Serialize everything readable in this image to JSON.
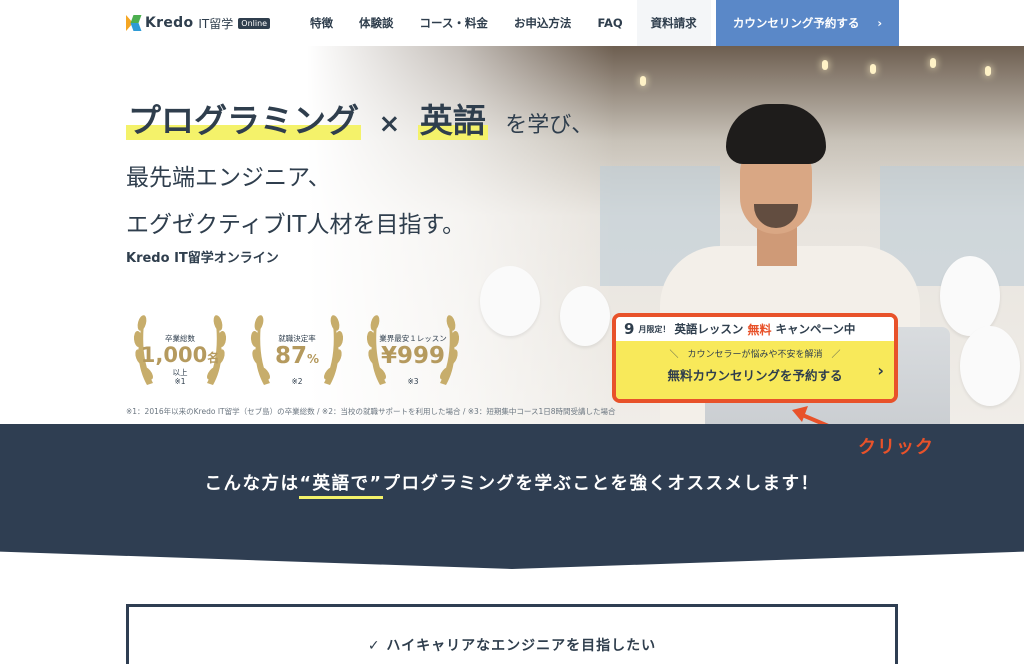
{
  "header": {
    "logo_text": "Kredo",
    "logo_sub": "IT留学",
    "logo_badge": "Online",
    "nav": [
      "特徴",
      "体験談",
      "コース・料金",
      "お申込方法",
      "FAQ",
      "資料請求"
    ],
    "cta_label": "カウンセリング予約する",
    "cta_chevron": "›",
    "cta_color": "#5a88c8"
  },
  "hero": {
    "line1_a": "プログラミング",
    "line1_x": "×",
    "line1_b": "英語",
    "line1_c": "を学び、",
    "line2": "最先端エンジニア、",
    "line3": "エグゼクティブIT人材を目指す。",
    "sub": "Kredo IT留学オンライン",
    "awards": [
      {
        "label": "卒業総数",
        "value": "1,000",
        "unit": "名",
        "extra": "以上",
        "note": "※1"
      },
      {
        "label": "就職決定率",
        "value": "87",
        "unit": "%",
        "extra": "",
        "note": "※2"
      },
      {
        "label": "業界最安１レッスン",
        "value": "¥999",
        "unit": "",
        "extra": "",
        "note": "※3"
      }
    ],
    "footnote": "※1：2016年以来のKredo IT留学（セブ島）の卒業総数 / ※2：当校の就職サポートを利用した場合 / ※3：短期集中コース1日8時間受講した場合",
    "accent_color": "#f4f26a",
    "gold_color": "#b59a5e"
  },
  "campaign": {
    "month": "9",
    "limited": "月限定！",
    "lesson": "英語レッスン",
    "free": "無料",
    "campaign": "キャンペーン中",
    "note": "＼　カウンセラーが悩みや不安を解消　／",
    "button": "無料カウンセリングを予約する",
    "chevron": "›",
    "border_color": "#e8522a"
  },
  "annotation": {
    "click_label": "クリック"
  },
  "band": {
    "text_a": "こんな方は",
    "text_ul": "“英語で”",
    "text_b": "プログラミングを学ぶことを強くオススメします！",
    "color": "#2f3e52"
  },
  "card": {
    "text": "✓ ハイキャリアなエンジニアを目指したい"
  }
}
